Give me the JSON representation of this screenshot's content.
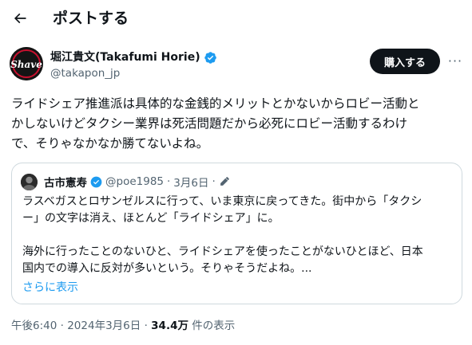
{
  "header": {
    "title": "ポストする",
    "back_icon": "arrow-left-icon"
  },
  "author": {
    "name": "堀江貴文(Takafumi Horie)",
    "handle": "@takapon_jp",
    "avatar_text": "Shave",
    "verified": true
  },
  "actions": {
    "buy_label": "購入する",
    "more_label": "···"
  },
  "tweet": {
    "lines": [
      "ライドシェア推進派は具体的な金銭的メリットとかないからロビー活動と",
      "かしないけどタクシー業界は死活問題だから必死にロビー活動するわけ",
      "で、そりゃなかなか勝てないよね。"
    ]
  },
  "quote": {
    "name": "古市憲寿",
    "handle": "@poe1985",
    "separator": "·",
    "date": "3月6日",
    "lines_p1": [
      "ラスベガスとロサンゼルスに行って、いま東京に戻ってきた。街中から「タクシ",
      "ー」の文字は消え、ほとんど「ライドシェア」に。"
    ],
    "lines_p2": [
      "海外に行ったことのないひと、ライドシェアを使ったことがないひとほど、日本",
      "国内での導入に反対が多いという。そりゃそうだよね。..."
    ],
    "show_more": "さらに表示"
  },
  "meta": {
    "time": "午後6:40",
    "separator": "·",
    "date": "2024年3月6日",
    "views_count": "34.4万",
    "views_label": "件の表示"
  },
  "colors": {
    "verified_blue": "#1d9bf0",
    "text": "#0f1419",
    "muted": "#536471",
    "border": "#cfd9de"
  }
}
